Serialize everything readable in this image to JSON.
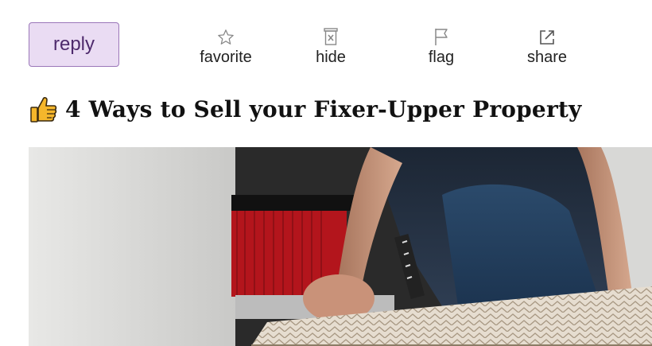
{
  "toolbar": {
    "reply_label": "reply",
    "actions": [
      {
        "label": "favorite",
        "icon": "star-outline-icon"
      },
      {
        "label": "hide",
        "icon": "trash-x-icon"
      },
      {
        "label": "flag",
        "icon": "flag-icon"
      },
      {
        "label": "share",
        "icon": "external-link-icon"
      }
    ]
  },
  "post": {
    "title": "4 Ways to Sell your Fixer-Upper Property",
    "title_icon": "thumbs-up-icon",
    "image_alt": "worker-tearing-up-floor-photo"
  },
  "colors": {
    "reply_bg": "#eadcf3",
    "reply_border": "#9b77b9",
    "reply_text": "#4e2a6c",
    "thumb_yellow": "#f5b62b"
  }
}
